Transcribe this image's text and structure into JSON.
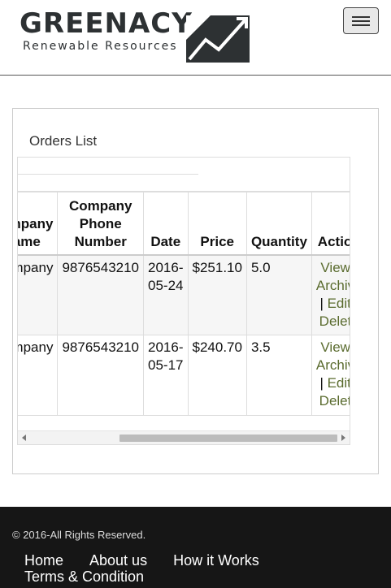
{
  "header": {
    "logo_word": "GREENACY",
    "logo_sub": "Renewable Resources",
    "menu_toggle_icon": "hamburger-icon"
  },
  "panel": {
    "title": "Orders List"
  },
  "table": {
    "columns": [
      "Company Name",
      "Company Phone Number",
      "Date",
      "Price",
      "Quantity",
      "Action"
    ],
    "rows": [
      {
        "company": "Company",
        "phone": "9876543210",
        "date": "2016-05-24",
        "price": "$251.10",
        "quantity": "5.0",
        "actions": [
          "View",
          "Archive",
          "Edit",
          "Delete"
        ]
      },
      {
        "company": "Company",
        "phone": "9876543210",
        "date": "2016-05-17",
        "price": "$240.70",
        "quantity": "3.5",
        "actions": [
          "View",
          "Archive",
          "Edit",
          "Delete"
        ]
      }
    ]
  },
  "footer": {
    "copyright": "© 2016-All Rights Reserved.",
    "links": [
      "Home",
      "About us",
      "How it Works",
      "Terms & Condition"
    ]
  },
  "colors": {
    "link": "#5a6b2e",
    "footer_bg": "#161616"
  }
}
